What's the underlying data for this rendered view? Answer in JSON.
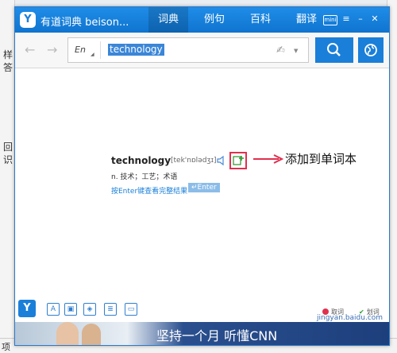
{
  "app": {
    "title": "有道词典 beison...",
    "tabs": [
      "词典",
      "例句",
      "百科",
      "翻译"
    ],
    "mini_label": "mini"
  },
  "search": {
    "language": "En",
    "query": "technology"
  },
  "result": {
    "word": "technology",
    "phonetic": "[tek'nɒlədʒɪ]",
    "definition": "n. 技术；工艺；术语",
    "hint": "按Enter键查看完整结果",
    "enter_label": "↵Enter"
  },
  "annotation": {
    "text": "添加到单词本"
  },
  "bottom": {
    "cancel_label": "取词",
    "wordlist_label": "划词",
    "banner_text": "坚持一个月 听懂CNN",
    "watermark": "jingyan.baidu.com"
  },
  "background": {
    "left_chars": [
      "样",
      "答",
      "回",
      "识"
    ],
    "bottom_char": "项"
  },
  "colors": {
    "titlebar": "#1a7fd9",
    "accent": "#1a7fd9",
    "highlight": "#e0304e"
  }
}
